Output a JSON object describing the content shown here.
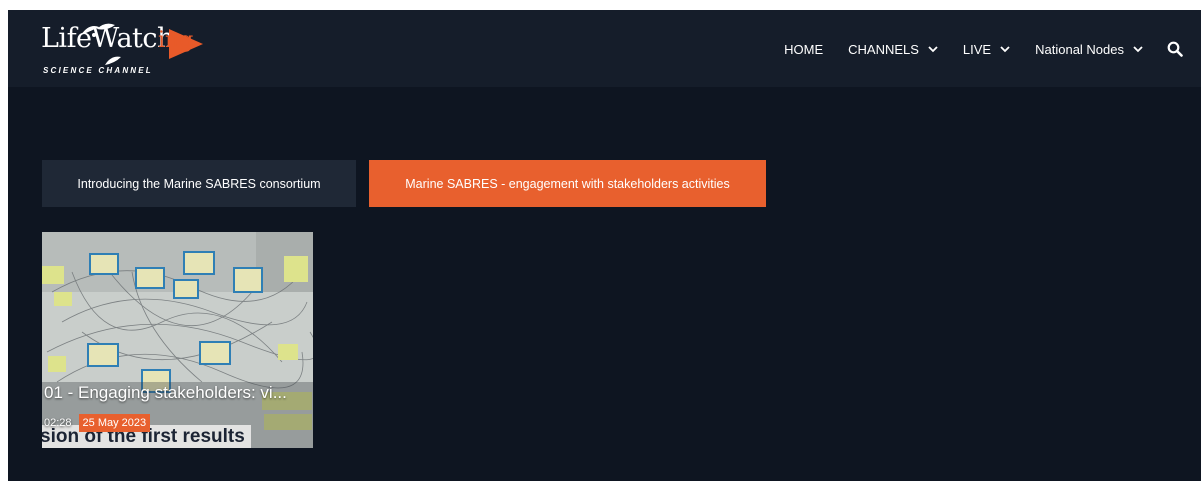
{
  "header": {
    "logo": {
      "main": "LifeWatch",
      "suffix": "ing",
      "subtitle": "SCIENCE CHANNEL"
    },
    "nav": [
      {
        "label": "HOME",
        "dropdown": false
      },
      {
        "label": "CHANNELS",
        "dropdown": true
      },
      {
        "label": "LIVE",
        "dropdown": true
      },
      {
        "label": "National Nodes",
        "dropdown": true
      }
    ],
    "search_icon": "search-icon"
  },
  "tabs": [
    {
      "label": "Introducing the Marine SABRES consortium",
      "active": false
    },
    {
      "label": "Marine SABRES - engagement with stakeholders activities",
      "active": true
    }
  ],
  "videos": [
    {
      "title": "01 - Engaging stakeholders: vi...",
      "duration": "02:28",
      "date": "25 May 2023",
      "overlay_text": "sion of the first results"
    }
  ],
  "colors": {
    "background": "#0e1521",
    "header": "#151d2a",
    "accent": "#e8602e",
    "tab_inactive": "#1f2836"
  }
}
